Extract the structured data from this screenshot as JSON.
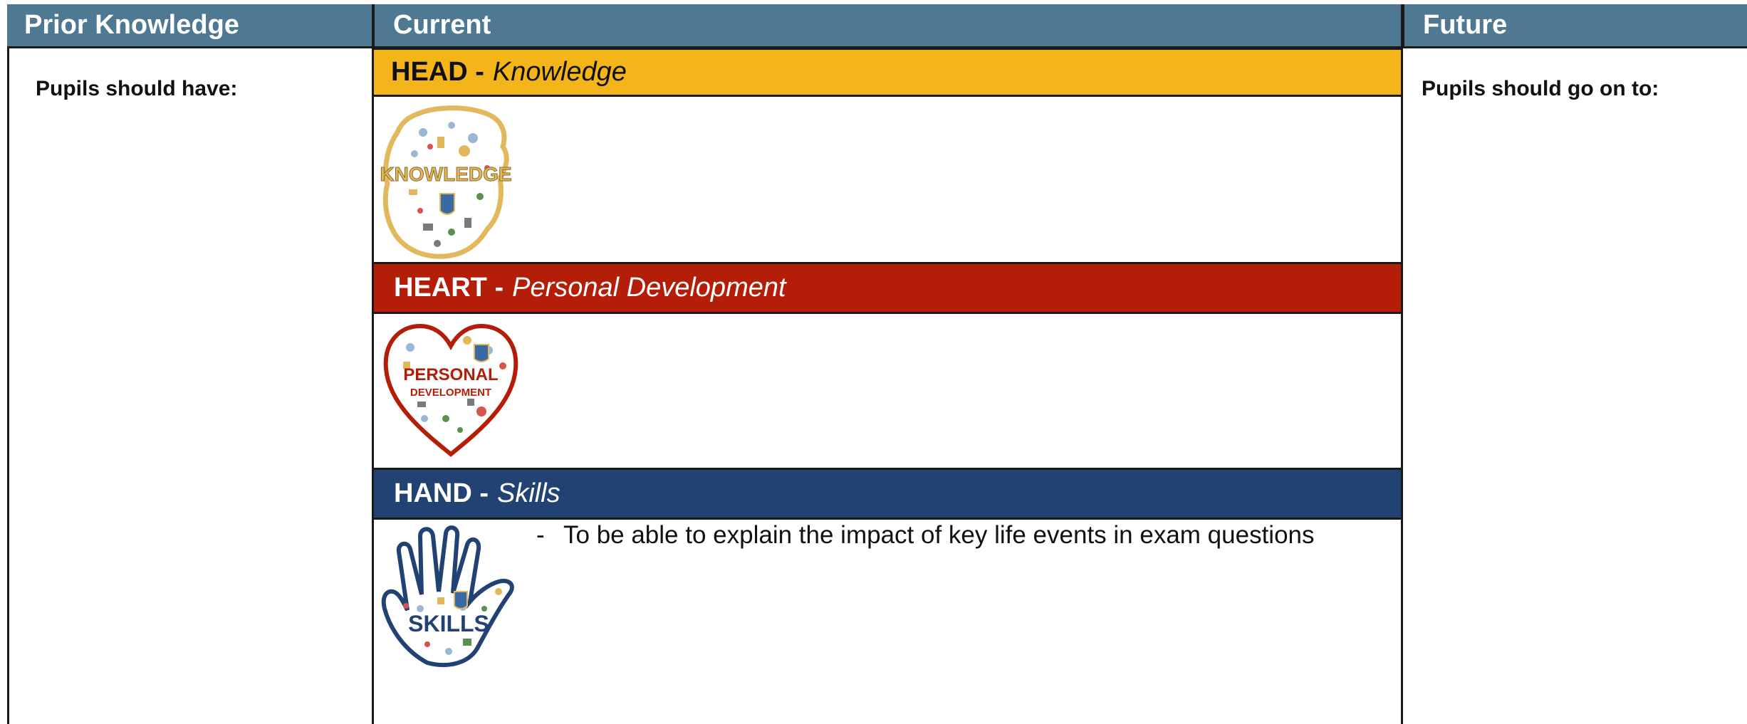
{
  "columns": {
    "prior": "Prior Knowledge",
    "current": "Current",
    "future": "Future"
  },
  "prior": {
    "text": "Pupils should have:"
  },
  "future": {
    "text": "Pupils should go on to:"
  },
  "bands": {
    "head": {
      "bold": "HEAD -",
      "italic": "Knowledge",
      "color": "#f4b51b",
      "icon": "knowledge-head-icon",
      "icon_text": "KNOWLEDGE"
    },
    "heart": {
      "bold": "HEART -",
      "italic": "Personal Development",
      "color": "#b41e08",
      "icon": "personal-development-heart-icon",
      "icon_text_1": "PERSONAL",
      "icon_text_2": "DEVELOPMENT"
    },
    "hand": {
      "bold": "HAND -",
      "italic": "Skills",
      "color": "#224274",
      "icon": "skills-hand-icon",
      "icon_text": "SKILLS"
    }
  },
  "skills": {
    "items": [
      {
        "dash": "-",
        "text": "To be able to explain the impact of key life events in exam questions"
      }
    ]
  },
  "colors": {
    "header": "#4f7893",
    "border": "#1a1a1a"
  }
}
